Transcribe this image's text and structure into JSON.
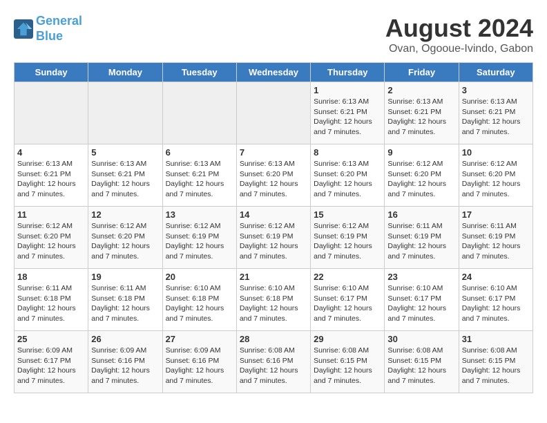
{
  "header": {
    "logo_line1": "General",
    "logo_line2": "Blue",
    "main_title": "August 2024",
    "sub_title": "Ovan, Ogooue-Ivindo, Gabon"
  },
  "weekdays": [
    "Sunday",
    "Monday",
    "Tuesday",
    "Wednesday",
    "Thursday",
    "Friday",
    "Saturday"
  ],
  "weeks": [
    [
      {
        "day": "",
        "detail": ""
      },
      {
        "day": "",
        "detail": ""
      },
      {
        "day": "",
        "detail": ""
      },
      {
        "day": "",
        "detail": ""
      },
      {
        "day": "1",
        "detail": "Sunrise: 6:13 AM\nSunset: 6:21 PM\nDaylight: 12 hours and 7 minutes."
      },
      {
        "day": "2",
        "detail": "Sunrise: 6:13 AM\nSunset: 6:21 PM\nDaylight: 12 hours and 7 minutes."
      },
      {
        "day": "3",
        "detail": "Sunrise: 6:13 AM\nSunset: 6:21 PM\nDaylight: 12 hours and 7 minutes."
      }
    ],
    [
      {
        "day": "4",
        "detail": "Sunrise: 6:13 AM\nSunset: 6:21 PM\nDaylight: 12 hours and 7 minutes."
      },
      {
        "day": "5",
        "detail": "Sunrise: 6:13 AM\nSunset: 6:21 PM\nDaylight: 12 hours and 7 minutes."
      },
      {
        "day": "6",
        "detail": "Sunrise: 6:13 AM\nSunset: 6:21 PM\nDaylight: 12 hours and 7 minutes."
      },
      {
        "day": "7",
        "detail": "Sunrise: 6:13 AM\nSunset: 6:20 PM\nDaylight: 12 hours and 7 minutes."
      },
      {
        "day": "8",
        "detail": "Sunrise: 6:13 AM\nSunset: 6:20 PM\nDaylight: 12 hours and 7 minutes."
      },
      {
        "day": "9",
        "detail": "Sunrise: 6:12 AM\nSunset: 6:20 PM\nDaylight: 12 hours and 7 minutes."
      },
      {
        "day": "10",
        "detail": "Sunrise: 6:12 AM\nSunset: 6:20 PM\nDaylight: 12 hours and 7 minutes."
      }
    ],
    [
      {
        "day": "11",
        "detail": "Sunrise: 6:12 AM\nSunset: 6:20 PM\nDaylight: 12 hours and 7 minutes."
      },
      {
        "day": "12",
        "detail": "Sunrise: 6:12 AM\nSunset: 6:20 PM\nDaylight: 12 hours and 7 minutes."
      },
      {
        "day": "13",
        "detail": "Sunrise: 6:12 AM\nSunset: 6:19 PM\nDaylight: 12 hours and 7 minutes."
      },
      {
        "day": "14",
        "detail": "Sunrise: 6:12 AM\nSunset: 6:19 PM\nDaylight: 12 hours and 7 minutes."
      },
      {
        "day": "15",
        "detail": "Sunrise: 6:12 AM\nSunset: 6:19 PM\nDaylight: 12 hours and 7 minutes."
      },
      {
        "day": "16",
        "detail": "Sunrise: 6:11 AM\nSunset: 6:19 PM\nDaylight: 12 hours and 7 minutes."
      },
      {
        "day": "17",
        "detail": "Sunrise: 6:11 AM\nSunset: 6:19 PM\nDaylight: 12 hours and 7 minutes."
      }
    ],
    [
      {
        "day": "18",
        "detail": "Sunrise: 6:11 AM\nSunset: 6:18 PM\nDaylight: 12 hours and 7 minutes."
      },
      {
        "day": "19",
        "detail": "Sunrise: 6:11 AM\nSunset: 6:18 PM\nDaylight: 12 hours and 7 minutes."
      },
      {
        "day": "20",
        "detail": "Sunrise: 6:10 AM\nSunset: 6:18 PM\nDaylight: 12 hours and 7 minutes."
      },
      {
        "day": "21",
        "detail": "Sunrise: 6:10 AM\nSunset: 6:18 PM\nDaylight: 12 hours and 7 minutes."
      },
      {
        "day": "22",
        "detail": "Sunrise: 6:10 AM\nSunset: 6:17 PM\nDaylight: 12 hours and 7 minutes."
      },
      {
        "day": "23",
        "detail": "Sunrise: 6:10 AM\nSunset: 6:17 PM\nDaylight: 12 hours and 7 minutes."
      },
      {
        "day": "24",
        "detail": "Sunrise: 6:10 AM\nSunset: 6:17 PM\nDaylight: 12 hours and 7 minutes."
      }
    ],
    [
      {
        "day": "25",
        "detail": "Sunrise: 6:09 AM\nSunset: 6:17 PM\nDaylight: 12 hours and 7 minutes."
      },
      {
        "day": "26",
        "detail": "Sunrise: 6:09 AM\nSunset: 6:16 PM\nDaylight: 12 hours and 7 minutes."
      },
      {
        "day": "27",
        "detail": "Sunrise: 6:09 AM\nSunset: 6:16 PM\nDaylight: 12 hours and 7 minutes."
      },
      {
        "day": "28",
        "detail": "Sunrise: 6:08 AM\nSunset: 6:16 PM\nDaylight: 12 hours and 7 minutes."
      },
      {
        "day": "29",
        "detail": "Sunrise: 6:08 AM\nSunset: 6:15 PM\nDaylight: 12 hours and 7 minutes."
      },
      {
        "day": "30",
        "detail": "Sunrise: 6:08 AM\nSunset: 6:15 PM\nDaylight: 12 hours and 7 minutes."
      },
      {
        "day": "31",
        "detail": "Sunrise: 6:08 AM\nSunset: 6:15 PM\nDaylight: 12 hours and 7 minutes."
      }
    ]
  ]
}
